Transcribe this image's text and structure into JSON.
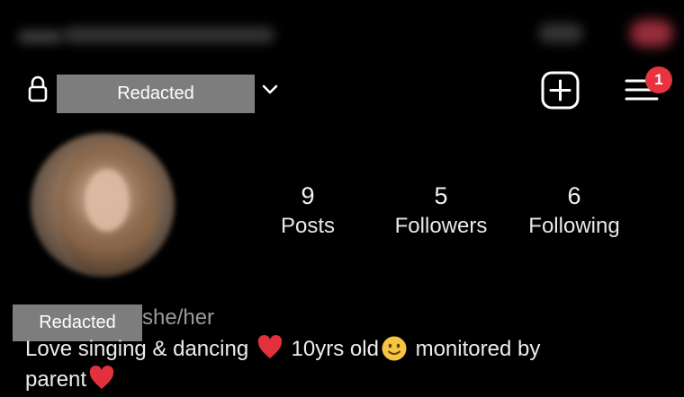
{
  "header": {
    "username_redaction_label": "Redacted",
    "notification_count": "1"
  },
  "stats": [
    {
      "value": "9",
      "label": "Posts"
    },
    {
      "value": "5",
      "label": "Followers"
    },
    {
      "value": "6",
      "label": "Following"
    }
  ],
  "bio": {
    "name_redaction_label": "Redacted",
    "pronouns": "she/her",
    "part1": "Love singing & dancing",
    "part2": "10yrs old",
    "part3": "monitored by",
    "part4": "parent"
  },
  "icons": {
    "lock": "lock-icon",
    "dropdown": "chevron-down-icon",
    "create": "add-square-icon",
    "menu": "hamburger-menu-icon",
    "heart": "red-heart-emoji",
    "smile": "smiling-face-emoji"
  },
  "colors": {
    "background": "#000000",
    "badge": "#e8323f",
    "redaction_box": "#7d7d7d",
    "heart": "#e0313c",
    "smile": "#f5c542"
  }
}
